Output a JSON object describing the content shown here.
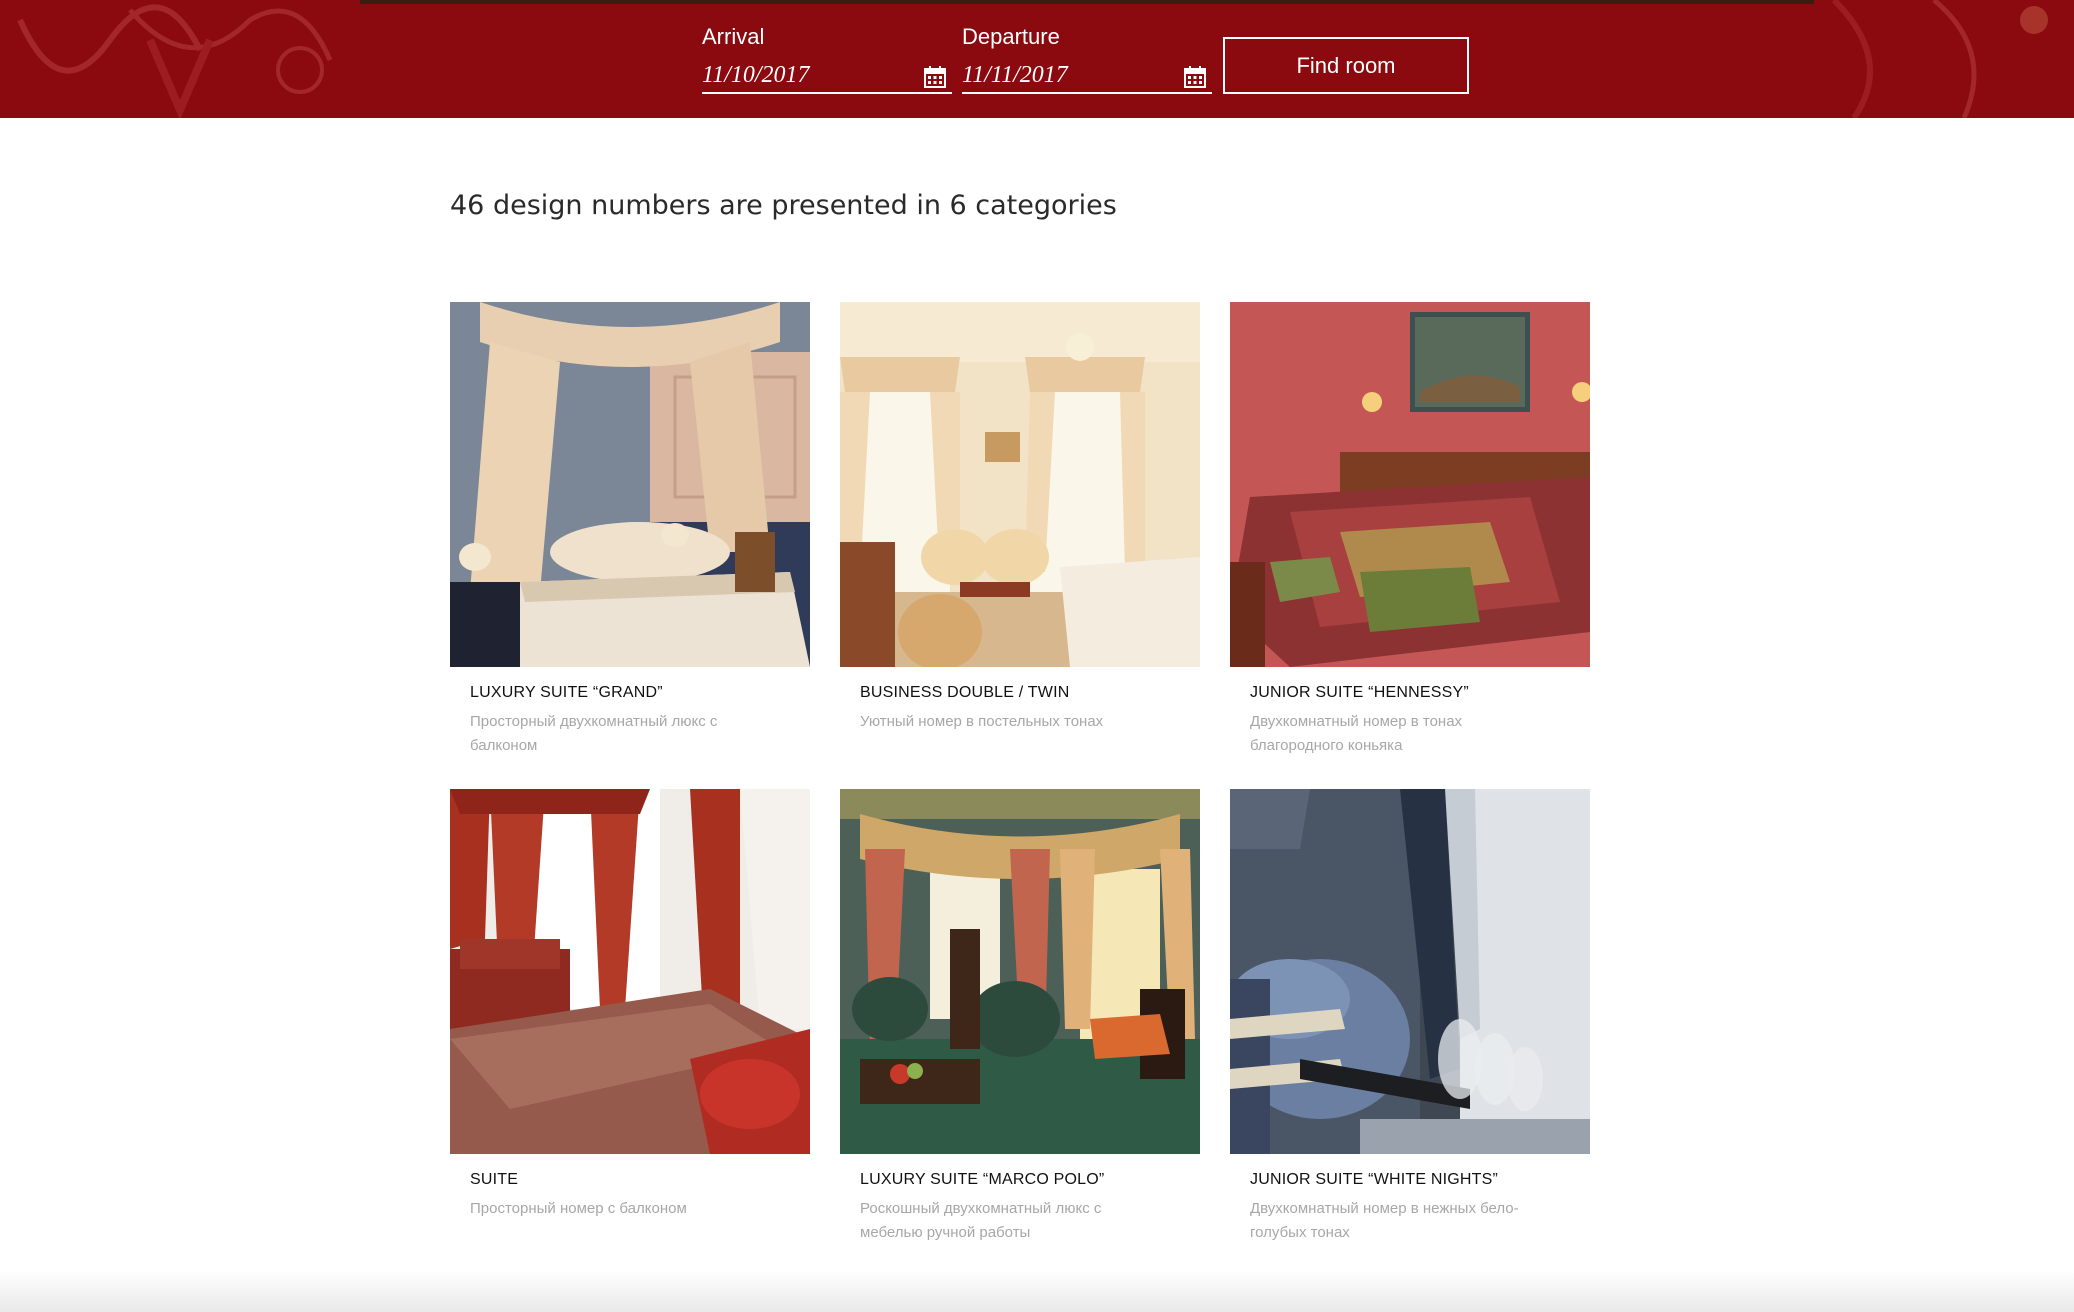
{
  "booking": {
    "arrival_label": "Arrival",
    "arrival_value": "11/10/2017",
    "departure_label": "Departure",
    "departure_value": "11/11/2017",
    "find_room_label": "Find room"
  },
  "heading": "46 design numbers are presented in 6 categories",
  "rooms": [
    {
      "title": "LUXURY SUITE “GRAND”",
      "description": "Просторный двухкомнатный люкс с балконом"
    },
    {
      "title": "BUSINESS DOUBLE / TWIN",
      "description": "Уютный номер в постельных тонах"
    },
    {
      "title": "JUNIOR SUITE “HENNESSY”",
      "description": "Двухкомнатный номер в тонах благородного коньяка"
    },
    {
      "title": "SUITE",
      "description": "Просторный номер с балконом"
    },
    {
      "title": "LUXURY SUITE “MARCO POLO”",
      "description": "Роскошный двухкомнатный люкс с мебелью ручной работы"
    },
    {
      "title": "JUNIOR SUITE “WHITE NIGHTS”",
      "description": "Двухкомнатный номер в нежных бело-голубых тонах"
    }
  ],
  "colors": {
    "header_red": "#8a0a0f",
    "title_text": "#111111",
    "description_text": "#a7a7a7"
  },
  "icons": [
    "calendar-icon"
  ]
}
